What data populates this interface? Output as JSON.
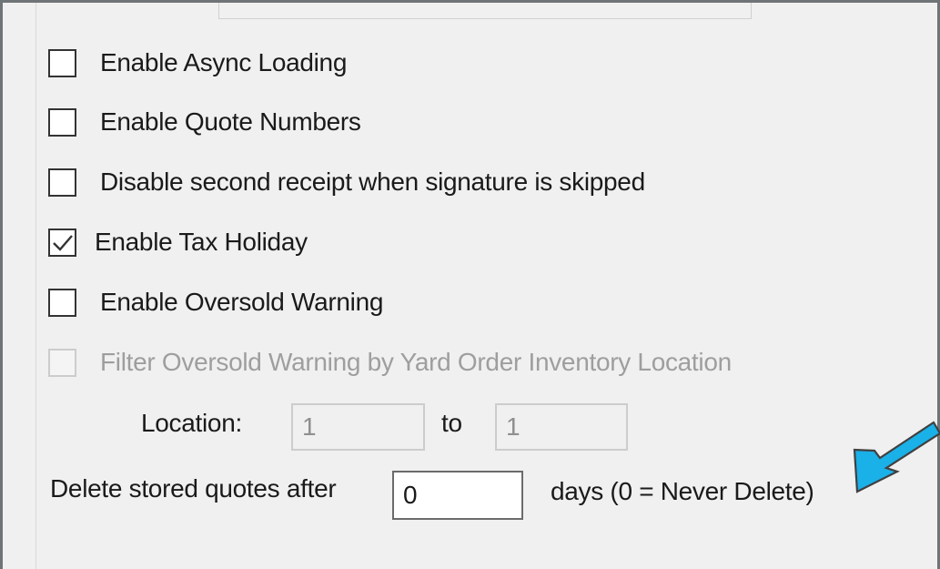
{
  "options": [
    {
      "label": "Enable Async Loading",
      "checked": false,
      "enabled": true
    },
    {
      "label": "Enable Quote Numbers",
      "checked": false,
      "enabled": true
    },
    {
      "label": "Disable second receipt when signature is skipped",
      "checked": false,
      "enabled": true
    },
    {
      "label": "Enable Tax Holiday",
      "checked": true,
      "enabled": true
    },
    {
      "label": "Enable Oversold Warning",
      "checked": false,
      "enabled": true
    },
    {
      "label": "Filter Oversold Warning by Yard Order Inventory Location",
      "checked": false,
      "enabled": false
    }
  ],
  "location": {
    "label": "Location:",
    "from_value": "1",
    "to_label": "to",
    "to_value": "1"
  },
  "delete_quotes": {
    "label": "Delete stored quotes after",
    "value": "0",
    "suffix": "days (0 = Never Delete)"
  },
  "colors": {
    "arrow": "#1ab0e8",
    "panel_background": "#f0f0f0",
    "border": "#6f7477"
  },
  "annotation": {
    "icon": "arrow-icon"
  }
}
